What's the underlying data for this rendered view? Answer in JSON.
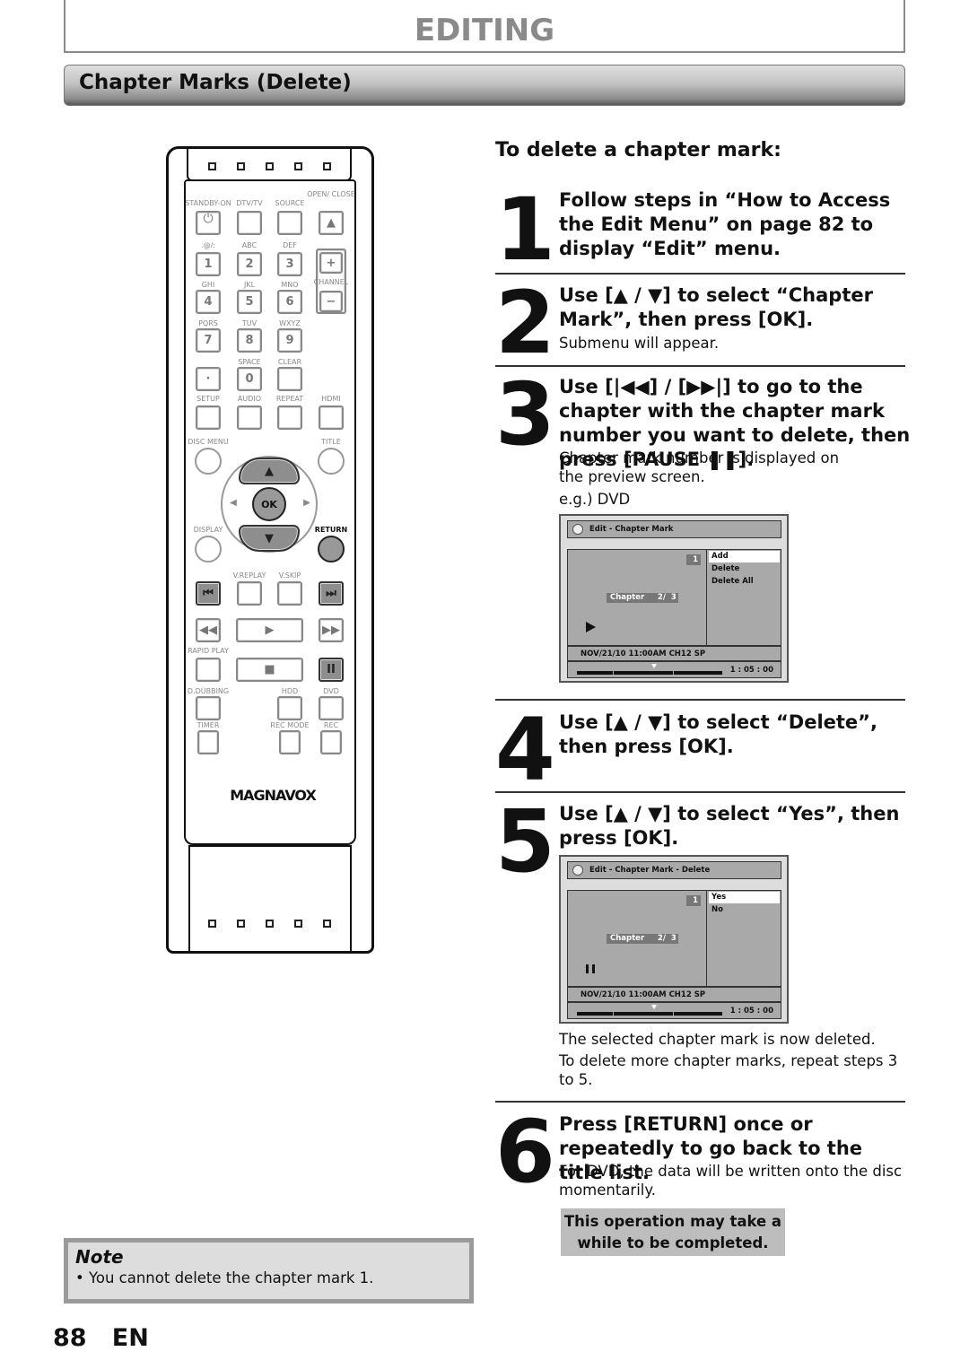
{
  "header": {
    "title": "EDITING",
    "section": "Chapter Marks (Delete)"
  },
  "remote": {
    "brand": "MAGNAVOX",
    "labels": {
      "standby": "STANDBY-ON",
      "dtv": "DTV/TV",
      "source": "SOURCE",
      "open": "OPEN/ CLOSE",
      "sym": ".@/:",
      "abc": "ABC",
      "def": "DEF",
      "ghi": "GHI",
      "jkl": "JKL",
      "mno": "MNO",
      "channel": "CHANNEL",
      "pqrs": "PQRS",
      "tuv": "TUV",
      "wxyz": "WXYZ",
      "space": "SPACE",
      "clear": "CLEAR",
      "setup": "SETUP",
      "audio": "AUDIO",
      "repeat": "REPEAT",
      "hdmi": "HDMI",
      "discmenu": "DISC MENU",
      "title": "TITLE",
      "display": "DISPLAY",
      "return": "RETURN",
      "vreplay": "V.REPLAY",
      "vskip": "V.SKIP",
      "rapid": "RAPID PLAY",
      "ddub": "D.DUBBING",
      "hdd": "HDD",
      "dvd": "DVD",
      "timer": "TIMER",
      "recmode": "REC MODE",
      "rec": "REC"
    },
    "keys": {
      "k1": "1",
      "k2": "2",
      "k3": "3",
      "k4": "4",
      "k5": "5",
      "k6": "6",
      "k7": "7",
      "k8": "8",
      "k9": "9",
      "k0": "0",
      "dot": "·",
      "plus": "+",
      "minus": "−",
      "ok": "OK",
      "eject": "▲",
      "up": "▲",
      "down": "▼",
      "left": "◀",
      "right": "▶",
      "prev": "⏮",
      "next": "⏭",
      "rew": "◀◀",
      "play": "▶",
      "ff": "▶▶",
      "stop": "■",
      "pause": "II"
    }
  },
  "instructions": {
    "heading": "To delete a chapter mark:",
    "steps": [
      {
        "num": "1",
        "title": "Follow steps in “How to Access the Edit Menu” on page 82 to display “Edit” menu."
      },
      {
        "num": "2",
        "title": "Use [▲ / ▼] to select “Chapter Mark”, then press [OK].",
        "text": "Submenu will appear."
      },
      {
        "num": "3",
        "title": "Use [|◀◀] / [▶▶|] to go to the chapter with the chapter mark number you want to delete, then press [PAUSE ❚❚].",
        "text": "Chapter mark number is displayed on the preview screen.",
        "example": "e.g.) DVD"
      },
      {
        "num": "4",
        "title": "Use [▲ / ▼] to select “Delete”, then press [OK]."
      },
      {
        "num": "5",
        "title": "Use [▲ / ▼] to select “Yes”, then press [OK].",
        "text": "The selected chapter mark is now deleted.",
        "text2": "To delete more chapter marks, repeat steps 3 to 5."
      },
      {
        "num": "6",
        "title": "Press [RETURN] once or repeatedly to go back to the title list.",
        "text": "For DVD, the data will be written onto the disc momentarily."
      }
    ]
  },
  "screen1": {
    "title": "Edit - Chapter Mark",
    "menu": [
      "Add",
      "Delete",
      "Delete All"
    ],
    "selected": "Add",
    "mark_number": "1",
    "chapter": "Chapter     2/  3",
    "status_icon": "play",
    "info": "NOV/21/10 11:00AM CH12 SP",
    "time": "1 : 05 : 00"
  },
  "screen2": {
    "title": "Edit - Chapter Mark - Delete",
    "menu": [
      "Yes",
      "No"
    ],
    "selected": "Yes",
    "mark_number": "1",
    "chapter": "Chapter     2/  3",
    "status_icon": "pause",
    "info": "NOV/21/10 11:00AM CH12 SP",
    "time": "1 : 05 : 00"
  },
  "callout": "This operation may take a while to be completed.",
  "note": {
    "title": "Note",
    "items": [
      "You cannot delete the chapter mark 1."
    ]
  },
  "footer": {
    "page": "88",
    "lang": "EN"
  }
}
